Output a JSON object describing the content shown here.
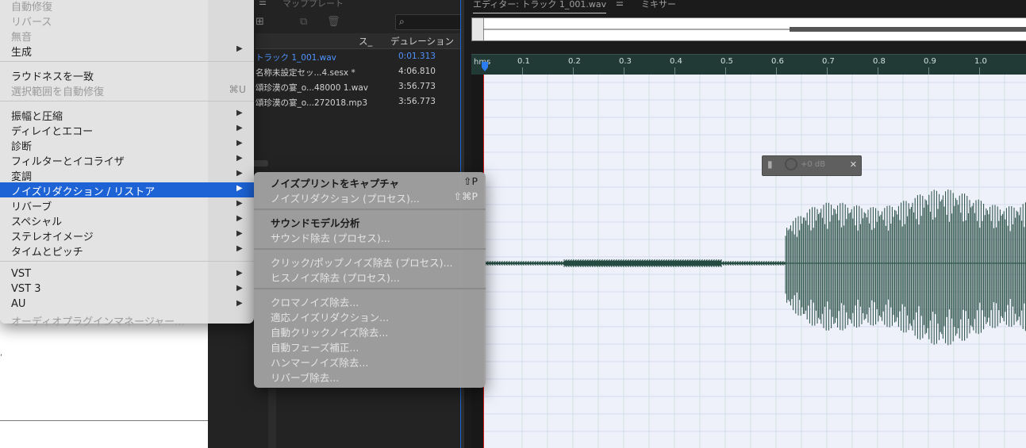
{
  "colors": {
    "menu_highlight": "#1d63d6",
    "wave_bg": "#eef0fa",
    "waveform": "#244b40",
    "ruler_bg": "#223a36",
    "selected_file": "#4f93ff",
    "playhead": "#2a7cf0"
  },
  "main_menu": {
    "items": [
      {
        "label": "自動修復",
        "disabled": true
      },
      {
        "label": "リバース",
        "disabled": true
      },
      {
        "label": "無音",
        "disabled": true
      },
      {
        "label": "生成",
        "submenu": true
      },
      {
        "label": "ラウドネスを一致"
      },
      {
        "label": "選択範囲を自動修復",
        "disabled": true,
        "shortcut": "⌘U"
      },
      {
        "label": "振幅と圧縮",
        "submenu": true
      },
      {
        "label": "ディレイとエコー",
        "submenu": true
      },
      {
        "label": "診断",
        "submenu": true
      },
      {
        "label": "フィルターとイコライザ",
        "submenu": true
      },
      {
        "label": "変調",
        "submenu": true
      },
      {
        "label": "ノイズリダクション / リストア",
        "submenu": true,
        "highlighted": true
      },
      {
        "label": "リバーブ",
        "submenu": true
      },
      {
        "label": "スペシャル",
        "submenu": true
      },
      {
        "label": "ステレオイメージ",
        "submenu": true
      },
      {
        "label": "タイムとピッチ",
        "submenu": true
      },
      {
        "label": "VST",
        "submenu": true
      },
      {
        "label": "VST 3",
        "submenu": true
      },
      {
        "label": "AU",
        "submenu": true
      },
      {
        "label": "オーディオプラグインマネージャー...",
        "disabled": true
      }
    ],
    "arrow": "▶"
  },
  "sub_menu": {
    "items": [
      {
        "label": "ノイズプリントをキャプチャ",
        "shortcut": "⇧P",
        "strong": true
      },
      {
        "label": "ノイズリダクション (プロセス)...",
        "shortcut": "⇧⌘P",
        "disabled": true
      },
      {
        "label": "サウンドモデル分析",
        "strong": true
      },
      {
        "label": "サウンド除去 (プロセス)...",
        "disabled": true
      },
      {
        "label": "クリック/ポップノイズ除去 (プロセス)...",
        "disabled": true
      },
      {
        "label": "ヒスノイズ除去 (プロセス)...",
        "disabled": true
      },
      {
        "label": "クロマノイズ除去...",
        "disabled": true
      },
      {
        "label": "適応ノイズリダクション...",
        "disabled": true
      },
      {
        "label": "自動クリックノイズ除去...",
        "disabled": true
      },
      {
        "label": "自動フェーズ補正...",
        "disabled": true
      },
      {
        "label": "ハンマーノイズ除去...",
        "disabled": true
      },
      {
        "label": "リバーブ除去...",
        "disabled": true
      }
    ]
  },
  "files_panel": {
    "tab_menu": "☰",
    "tab_label": "マッププレート",
    "columns": {
      "status": "ス_",
      "duration": "デュレーション"
    },
    "search_icon": "⌕",
    "rows": [
      {
        "name": "トラック 1_001.wav",
        "duration": "0:01.313",
        "selected": true
      },
      {
        "name": "名称未設定セッ...4.sesx *",
        "duration": "4:06.810"
      },
      {
        "name": "頌珍漠の宴_o...48000 1.wav",
        "duration": "3:56.773"
      },
      {
        "name": "頌珍漠の宴_o...272018.mp3",
        "duration": "3:56.773"
      }
    ]
  },
  "editor": {
    "tab_label": "エディター: トラック 1_001.wav",
    "tab_menu": "☰",
    "mixer_label": "ミキサー",
    "ruler_unit": "hms",
    "ruler_ticks": [
      "0.1",
      "0.2",
      "0.3",
      "0.4",
      "0.5",
      "0.6",
      "0.7",
      "0.8",
      "0.9",
      "1.0"
    ],
    "hud_value": "+0 dB",
    "hud_pin": "✕"
  }
}
